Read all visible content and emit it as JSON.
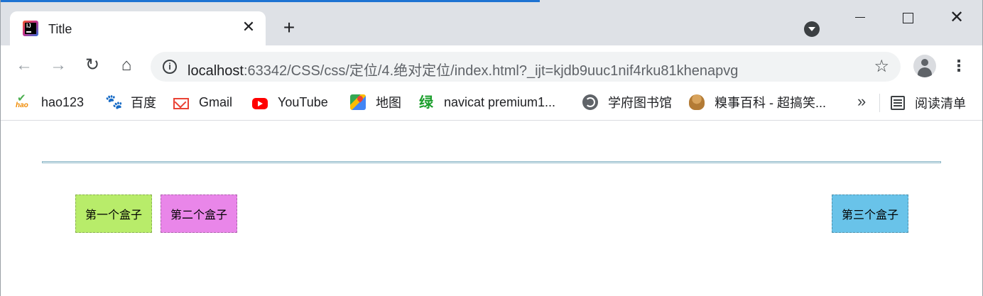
{
  "tab": {
    "title": "Title",
    "close": "✕",
    "new_tab": "+"
  },
  "window": {
    "close": "✕"
  },
  "toolbar": {
    "back": "←",
    "forward": "→",
    "reload": "↻",
    "home": "⌂",
    "info": "i",
    "url_host": "localhost",
    "url_rest": ":63342/CSS/css/定位/4.绝对定位/index.html?_ijt=kjdb9uuc1nif4rku81khenapvg",
    "star": "☆",
    "menu": "⋮"
  },
  "bookmarks": {
    "items": [
      {
        "label": "hao123",
        "icon": "hao123-icon"
      },
      {
        "label": "百度",
        "icon": "baidu-paw-icon"
      },
      {
        "label": "Gmail",
        "icon": "gmail-icon"
      },
      {
        "label": "YouTube",
        "icon": "youtube-icon"
      },
      {
        "label": "地图",
        "icon": "google-maps-icon"
      },
      {
        "label": "navicat premium1...",
        "icon": "green-lv-icon"
      },
      {
        "label": "学府图书馆",
        "icon": "globe-icon"
      },
      {
        "label": "糗事百科 - 超搞笑...",
        "icon": "poop-icon"
      }
    ],
    "more": "»",
    "reading_list": "阅读清单",
    "baidu_glyph": "🐾",
    "lv_glyph": "绿"
  },
  "page": {
    "box1": "第一个盒子",
    "box2": "第二个盒子",
    "box3": "第三个盒子"
  },
  "colors": {
    "box1": "#b8ec6a",
    "box2": "#e986e9",
    "box3": "#69c3e9"
  }
}
